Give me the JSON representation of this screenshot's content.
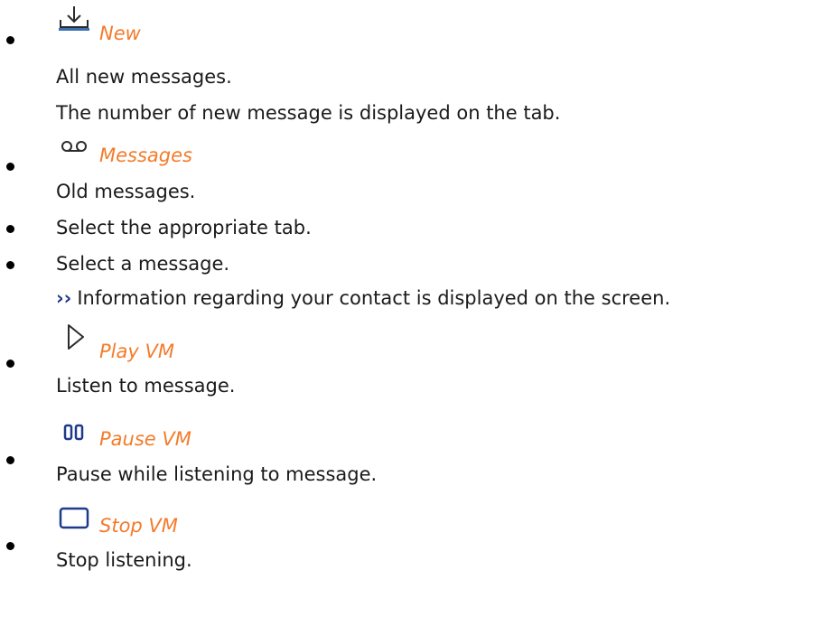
{
  "accent_color": "#f47b2a",
  "items": [
    {
      "icon": "download-tray-icon",
      "label": "New",
      "lines": [
        "All new messages.",
        "The number of new message is displayed on the tab."
      ]
    },
    {
      "icon": "voicemail-icon",
      "label": "Messages",
      "lines": [
        "Old messages."
      ]
    },
    {
      "text": "Select the appropriate tab."
    },
    {
      "text": "Select a message.",
      "result_marker": "››",
      "result": "Information regarding your contact is displayed on the screen."
    },
    {
      "icon": "play-icon",
      "label": "Play VM",
      "lines": [
        "Listen to message."
      ]
    },
    {
      "icon": "pause-icon",
      "label": "Pause VM",
      "lines": [
        "Pause while listening to message."
      ]
    },
    {
      "icon": "stop-icon",
      "label": "Stop VM",
      "lines": [
        "Stop listening."
      ]
    }
  ]
}
